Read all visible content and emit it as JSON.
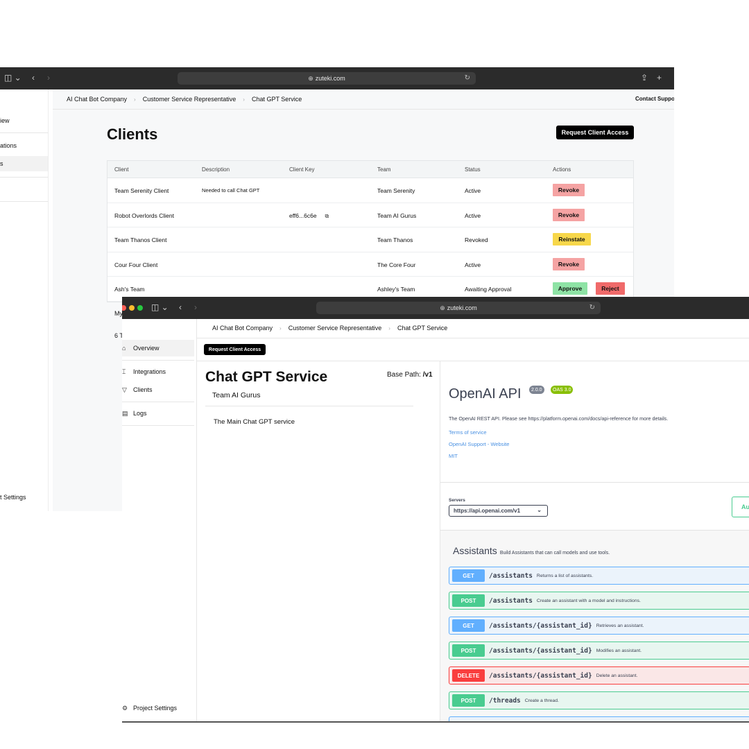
{
  "back_window": {
    "url": "zuteki.com",
    "breadcrumb": [
      "AI Chat Bot Company",
      "Customer Service Representative",
      "Chat GPT Service"
    ],
    "contact_label": "Contact Suppor",
    "sidebar": {
      "items": [
        "iew",
        "ations",
        "s"
      ],
      "settings_label": "t Settings"
    },
    "page_title": "Clients",
    "request_button": "Request Client Access",
    "table": {
      "headers": [
        "Client",
        "Description",
        "Client Key",
        "Team",
        "Status",
        "Actions"
      ],
      "rows": [
        {
          "client": "Team Serenity Client",
          "description": "Needed to call Chat GPT",
          "key": "",
          "team": "Team Serenity",
          "status": "Active",
          "actions": [
            "Revoke"
          ]
        },
        {
          "client": "Robot Overlords Client",
          "description": "",
          "key": "eff6...6c6e",
          "team": "Team AI Gurus",
          "status": "Active",
          "actions": [
            "Revoke"
          ]
        },
        {
          "client": "Team Thanos Client",
          "description": "",
          "key": "",
          "team": "Team Thanos",
          "status": "Revoked",
          "actions": [
            "Reinstate"
          ]
        },
        {
          "client": "Cour Four Client",
          "description": "",
          "key": "",
          "team": "The Core Four",
          "status": "Active",
          "actions": [
            "Revoke"
          ]
        },
        {
          "client": "Ash's Team",
          "description": "",
          "key": "",
          "team": "Ashley's Team",
          "status": "Awaiting Approval",
          "actions": [
            "Approve",
            "Reject"
          ]
        }
      ]
    },
    "partial_text_1": "My",
    "partial_text_2": "6 T"
  },
  "front_window": {
    "url": "zuteki.com",
    "breadcrumb": [
      "AI Chat Bot Company",
      "Customer Service Representative",
      "Chat GPT Service"
    ],
    "sidebar": {
      "items": [
        {
          "label": "Overview",
          "icon": "home-icon"
        },
        {
          "label": "Integrations",
          "icon": "integrations-icon"
        },
        {
          "label": "Clients",
          "icon": "clients-icon"
        },
        {
          "label": "Logs",
          "icon": "logs-icon"
        }
      ],
      "settings_label": "Project Settings"
    },
    "request_button": "Request Client Access",
    "service": {
      "title": "Chat GPT Service",
      "base_path_label": "Base Path:",
      "base_path_value": "/v1",
      "team": "Team AI Gurus",
      "description": "The Main Chat GPT service"
    },
    "api": {
      "title": "OpenAI API",
      "version": "2.0.0",
      "oas": "OAS 3.0",
      "description": "The OpenAI REST API. Please see https://platform.openai.com/docs/api-reference for more details.",
      "links": [
        "Terms of service",
        "OpenAI Support - Website",
        "MIT"
      ],
      "servers_label": "Servers",
      "server_value": "https://api.openai.com/v1",
      "auth_label": "Au",
      "tag": {
        "name": "Assistants",
        "description": "Build Assistants that can call models and use tools."
      },
      "operations": [
        {
          "method": "GET",
          "path": "/assistants",
          "summary": "Returns a list of assistants."
        },
        {
          "method": "POST",
          "path": "/assistants",
          "summary": "Create an assistant with a model and instructions."
        },
        {
          "method": "GET",
          "path": "/assistants/{assistant_id}",
          "summary": "Retrieves an assistant."
        },
        {
          "method": "POST",
          "path": "/assistants/{assistant_id}",
          "summary": "Modifies an assistant."
        },
        {
          "method": "DELETE",
          "path": "/assistants/{assistant_id}",
          "summary": "Delete an assistant."
        },
        {
          "method": "POST",
          "path": "/threads",
          "summary": "Create a thread."
        }
      ]
    }
  },
  "colors": {
    "get": "#61affe",
    "post": "#49cc90",
    "delete": "#f93e3e",
    "revoke": "#f5a3a3",
    "reinstate": "#f7d74a",
    "approve": "#8ee3a5",
    "reject": "#f06a6a"
  }
}
